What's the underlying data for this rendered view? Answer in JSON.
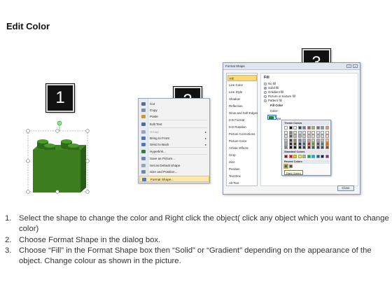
{
  "title": "Edit Color",
  "badges": [
    "1",
    "2",
    "3"
  ],
  "brick": {
    "top_color": "#2f7d22",
    "front_color": "#3b7d1f",
    "side_color": "#2a5a17",
    "handle_color": "#5fcf5a"
  },
  "context_menu": {
    "items": [
      {
        "label": "Cut",
        "icon": "scissors-icon",
        "icon_color": "#5a6f8c"
      },
      {
        "label": "Copy",
        "icon": "copy-icon",
        "icon_color": "#7e8fa8"
      },
      {
        "label": "Paste",
        "icon": "paste-icon",
        "icon_color": "#c59a3b"
      },
      {
        "label": "Edit Text",
        "icon": "text-edit-icon",
        "icon_color": "#4b6b9a"
      },
      {
        "label": "Group",
        "icon": "group-icon",
        "icon_color": "#9aa5b3",
        "disabled": true,
        "submenu": true
      },
      {
        "label": "Bring to Front",
        "icon": "bring-front-icon",
        "icon_color": "#4f79b8",
        "submenu": true
      },
      {
        "label": "Send to Back",
        "icon": "send-back-icon",
        "icon_color": "#4f79b8",
        "submenu": true
      },
      {
        "label": "Hyperlink...",
        "icon": "hyperlink-icon",
        "icon_color": "#3a7a3a"
      },
      {
        "label": "Save as Picture...",
        "icon": "save-picture-icon",
        "icon_color": "#6f86a6"
      },
      {
        "label": "Set as Default Shape",
        "icon": "default-shape-icon",
        "icon_color": "#9aa5b3"
      },
      {
        "label": "Size and Position...",
        "icon": "size-position-icon",
        "icon_color": "#6f86a6"
      },
      {
        "label": "Format Shape...",
        "icon": "format-shape-icon",
        "icon_color": "#4f79b8",
        "highlighted": true
      }
    ]
  },
  "dialog": {
    "title": "Format Shape",
    "close_label": "Close",
    "nav": [
      "Fill",
      "Line Color",
      "Line Style",
      "Shadow",
      "Reflection",
      "Glow and Soft Edges",
      "3-D Format",
      "3-D Rotation",
      "Picture Corrections",
      "Picture Color",
      "Artistic Effects",
      "Crop",
      "Size",
      "Position",
      "Text Box",
      "Alt Text"
    ],
    "selected_nav": "Fill",
    "fill_header": "Fill",
    "fill_options": [
      {
        "label": "No fill",
        "selected": false
      },
      {
        "label": "Solid fill",
        "selected": true
      },
      {
        "label": "Gradient fill",
        "selected": false
      },
      {
        "label": "Picture or texture fill",
        "selected": false
      },
      {
        "label": "Pattern fill",
        "selected": false
      }
    ],
    "fill_color_header": "Fill Color",
    "color_label": "Color:",
    "transparency_label": "Transpa"
  },
  "palette": {
    "theme_header": "Theme Colors",
    "standard_header": "Standard Colors",
    "recent_header": "Recent Colors",
    "theme_top": [
      "#ffffff",
      "#000000",
      "#eeece1",
      "#1f497d",
      "#4f81bd",
      "#c0504d",
      "#9bbb59",
      "#8064a2",
      "#4bacc6",
      "#f79646"
    ],
    "theme_shades": [
      [
        "#f2f2f2",
        "#7f7f7f",
        "#ddd9c3",
        "#c6d9f0",
        "#dbe5f1",
        "#f2dcdb",
        "#ebf1dd",
        "#e5e0ec",
        "#dbeef3",
        "#fdeada"
      ],
      [
        "#d8d8d8",
        "#595959",
        "#c4bd97",
        "#8db3e2",
        "#b8cce4",
        "#e5b9b7",
        "#d7e3bc",
        "#ccc1d9",
        "#b7dde8",
        "#fbd5b5"
      ],
      [
        "#bfbfbf",
        "#3f3f3f",
        "#938953",
        "#548dd4",
        "#95b3d7",
        "#d99694",
        "#c3d69b",
        "#b2a2c7",
        "#92cddc",
        "#fac08f"
      ],
      [
        "#a5a5a5",
        "#262626",
        "#494429",
        "#17365d",
        "#366092",
        "#953734",
        "#76923c",
        "#5f497a",
        "#31859b",
        "#e36c09"
      ],
      [
        "#7f7f7f",
        "#0c0c0c",
        "#1d1b10",
        "#0f243e",
        "#244061",
        "#632423",
        "#4f6128",
        "#3f3151",
        "#205867",
        "#974806"
      ]
    ],
    "standard": [
      "#c00000",
      "#ff0000",
      "#ffc000",
      "#ffff00",
      "#92d050",
      "#00b050",
      "#00b0f0",
      "#0070c0",
      "#002060",
      "#7030a0"
    ],
    "recent": [
      "#2f7d22",
      "#5f4a1e"
    ],
    "tooltip": "Dark Green"
  },
  "instructions": [
    {
      "num": "1.",
      "text": "Select the shape to change the color and Right click the object( click any object which you want to change color)"
    },
    {
      "num": "2.",
      "text": "Choose Format Shape in the dialog box."
    },
    {
      "num": "3.",
      "text": "Choose “Fill” in the Format Shape box then “Solid” or “Gradient” depending on the appearance of the object. Change colour as shown in the picture."
    }
  ]
}
